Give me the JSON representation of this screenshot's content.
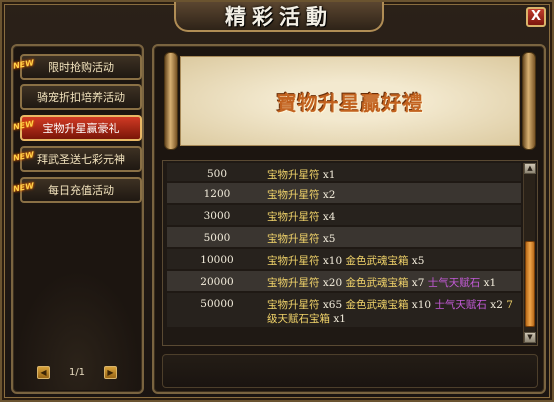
{
  "window": {
    "title": "精彩活動",
    "close_label": "X"
  },
  "sidebar": {
    "new_badge": "NEW",
    "items": [
      {
        "label": "限时抢购活动",
        "new": true,
        "active": false
      },
      {
        "label": "骑宠折扣培养活动",
        "new": false,
        "active": false
      },
      {
        "label": "宝物升星赢豪礼",
        "new": true,
        "active": true
      },
      {
        "label": "拜武圣送七彩元神",
        "new": true,
        "active": false
      },
      {
        "label": "每日充值活动",
        "new": true,
        "active": false
      }
    ],
    "pager": {
      "prev_label": "◀",
      "next_label": "▶",
      "text": "1/1"
    }
  },
  "banner": {
    "title": "寶物升星贏好禮"
  },
  "rewards": [
    {
      "amount": "500",
      "parts": [
        {
          "t": "宝物升星符",
          "c": "gold"
        },
        {
          "t": " x1",
          "c": "white"
        }
      ]
    },
    {
      "amount": "1200",
      "parts": [
        {
          "t": "宝物升星符",
          "c": "gold"
        },
        {
          "t": " x2",
          "c": "white"
        }
      ]
    },
    {
      "amount": "3000",
      "parts": [
        {
          "t": "宝物升星符",
          "c": "gold"
        },
        {
          "t": " x4",
          "c": "white"
        }
      ]
    },
    {
      "amount": "5000",
      "parts": [
        {
          "t": "宝物升星符",
          "c": "gold"
        },
        {
          "t": " x5",
          "c": "white"
        }
      ]
    },
    {
      "amount": "10000",
      "parts": [
        {
          "t": "宝物升星符",
          "c": "gold"
        },
        {
          "t": " x10 ",
          "c": "white"
        },
        {
          "t": "金色武魂宝箱",
          "c": "gold"
        },
        {
          "t": " x5",
          "c": "white"
        }
      ]
    },
    {
      "amount": "20000",
      "parts": [
        {
          "t": "宝物升星符",
          "c": "gold"
        },
        {
          "t": " x20 ",
          "c": "white"
        },
        {
          "t": "金色武魂宝箱",
          "c": "gold"
        },
        {
          "t": " x7 ",
          "c": "white"
        },
        {
          "t": "士气天赋石",
          "c": "purple"
        },
        {
          "t": " x1",
          "c": "white"
        }
      ]
    },
    {
      "amount": "50000",
      "parts": [
        {
          "t": "宝物升星符",
          "c": "gold"
        },
        {
          "t": " x65 ",
          "c": "white"
        },
        {
          "t": "金色武魂宝箱",
          "c": "gold"
        },
        {
          "t": " x10 ",
          "c": "white"
        },
        {
          "t": "士气天赋石",
          "c": "purple"
        },
        {
          "t": " x2 ",
          "c": "white"
        },
        {
          "t": "7级天赋石宝箱",
          "c": "gold"
        },
        {
          "t": " x1",
          "c": "white"
        }
      ]
    }
  ],
  "scrollbar": {
    "up_label": "▲",
    "down_label": "▼",
    "position": 0.9
  }
}
